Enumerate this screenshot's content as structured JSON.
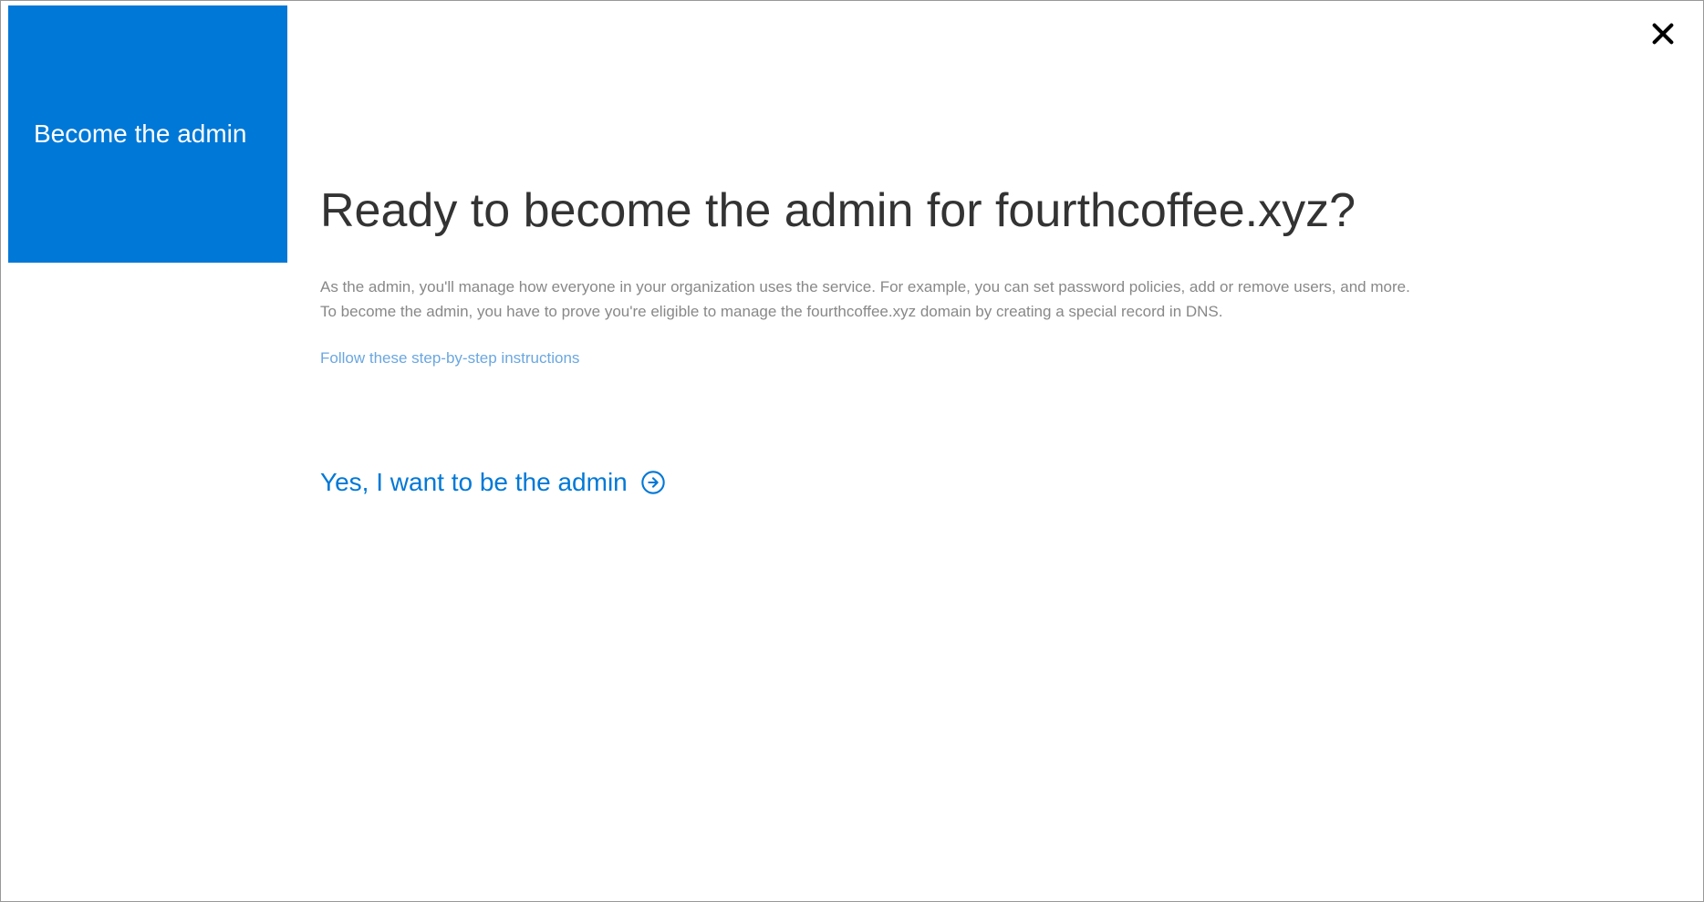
{
  "sidebar": {
    "title": "Become the admin"
  },
  "main": {
    "heading": "Ready to become the admin for fourthcoffee.xyz?",
    "description_line1": "As the admin, you'll manage how everyone in your organization uses the service. For example, you can set password policies, add or remove users, and more.",
    "description_line2": "To become the admin, you have to prove you're eligible to manage the fourthcoffee.xyz domain by creating a special record in DNS.",
    "instructions_link": "Follow these step-by-step instructions",
    "cta_label": "Yes, I want to be the admin"
  }
}
